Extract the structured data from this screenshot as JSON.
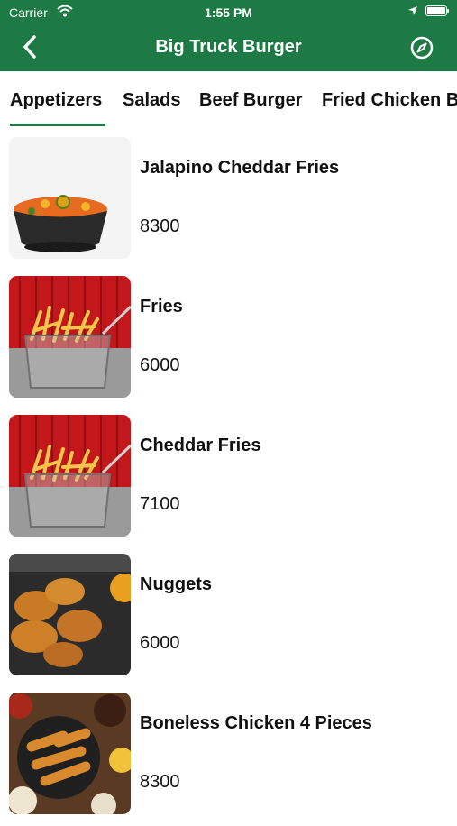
{
  "status_bar": {
    "carrier": "Carrier",
    "time": "1:55 PM"
  },
  "header": {
    "title": "Big Truck Burger",
    "back_icon": "chevron-left-icon",
    "action_icon": "compass-icon"
  },
  "colors": {
    "brand": "#1e7a44",
    "text": "#111111"
  },
  "tabs": [
    {
      "label": "Appetizers",
      "selected": true
    },
    {
      "label": "Salads",
      "selected": false
    },
    {
      "label": "Beef Burger",
      "selected": false
    },
    {
      "label": "Fried Chicken B",
      "selected": false
    }
  ],
  "items": [
    {
      "name": "Jalapino Cheddar Fries",
      "price": "8300"
    },
    {
      "name": "Fries",
      "price": "6000"
    },
    {
      "name": "Cheddar Fries",
      "price": "7100"
    },
    {
      "name": "Nuggets",
      "price": "6000"
    },
    {
      "name": "Boneless Chicken 4 Pieces",
      "price": "8300"
    }
  ]
}
